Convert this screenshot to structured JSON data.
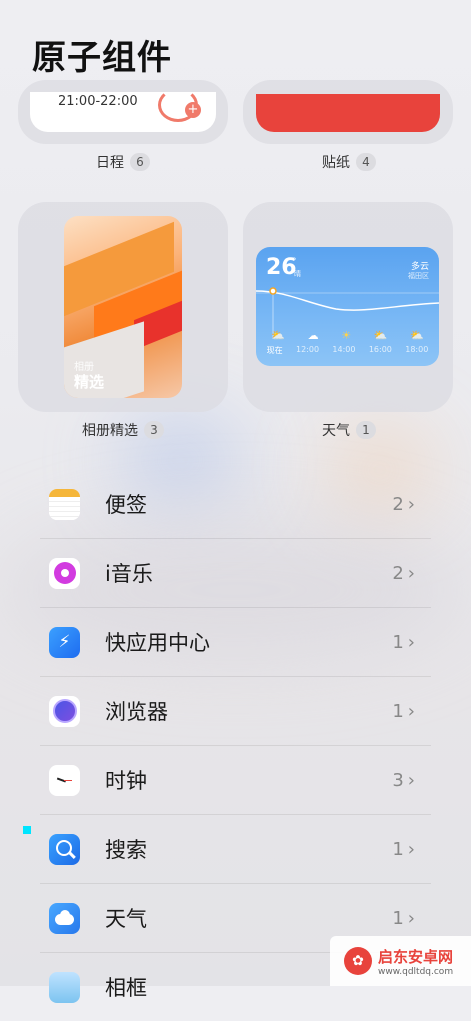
{
  "page": {
    "title": "原子组件"
  },
  "widgets": {
    "schedule": {
      "time_range": "21:00-22:00",
      "label": "日程",
      "count": "6"
    },
    "sticker": {
      "label": "贴纸",
      "count": "4",
      "color": "#e8433c"
    },
    "album": {
      "sub": "相册",
      "main": "精选",
      "label": "相册精选",
      "count": "3"
    },
    "weather": {
      "temp": "26",
      "deg": "°",
      "cond_small": "晴",
      "cond": "多云",
      "location": "福田区",
      "times": [
        "现在",
        "12:00",
        "14:00",
        "16:00",
        "18:00"
      ],
      "label": "天气",
      "count": "1"
    }
  },
  "apps": [
    {
      "name": "便签",
      "count": "2",
      "icon": "notes-icon"
    },
    {
      "name": "i音乐",
      "count": "2",
      "icon": "music-icon"
    },
    {
      "name": "快应用中心",
      "count": "1",
      "icon": "quick-app-icon"
    },
    {
      "name": "浏览器",
      "count": "1",
      "icon": "browser-icon"
    },
    {
      "name": "时钟",
      "count": "3",
      "icon": "clock-icon"
    },
    {
      "name": "搜索",
      "count": "1",
      "icon": "search-icon"
    },
    {
      "name": "天气",
      "count": "1",
      "icon": "weather-icon"
    },
    {
      "name": "相框",
      "count": "",
      "icon": "photo-frame-icon"
    }
  ],
  "chevron": "›",
  "watermark": {
    "name": "启东安卓网",
    "url": "www.qdltdq.com"
  }
}
